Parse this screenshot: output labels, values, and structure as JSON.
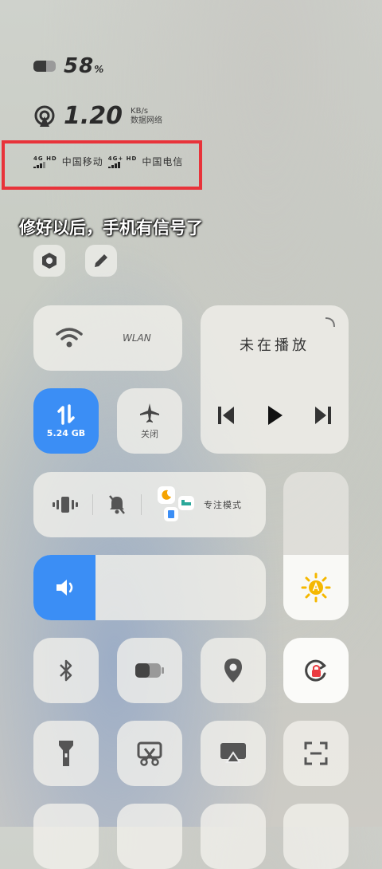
{
  "status": {
    "battery_value": "58",
    "battery_unit": "%",
    "network_speed": "1.20",
    "network_unit": "KB/s",
    "network_label": "数据网络",
    "sim1": {
      "type": "4G",
      "hd": "HD",
      "carrier": "中国移动"
    },
    "sim2": {
      "type": "4G+",
      "hd": "HD",
      "carrier": "中国电信"
    }
  },
  "caption": "修好以后，手机有信号了",
  "tiles": {
    "wlan_label": "WLAN",
    "media_title": "未在播放",
    "data_label": "5.24 GB",
    "airplane_label": "关闭",
    "focus_label": "专注模式"
  },
  "colors": {
    "accent": "#3b8ef5",
    "highlight_box": "#e8333a",
    "sun": "#f5b800"
  }
}
